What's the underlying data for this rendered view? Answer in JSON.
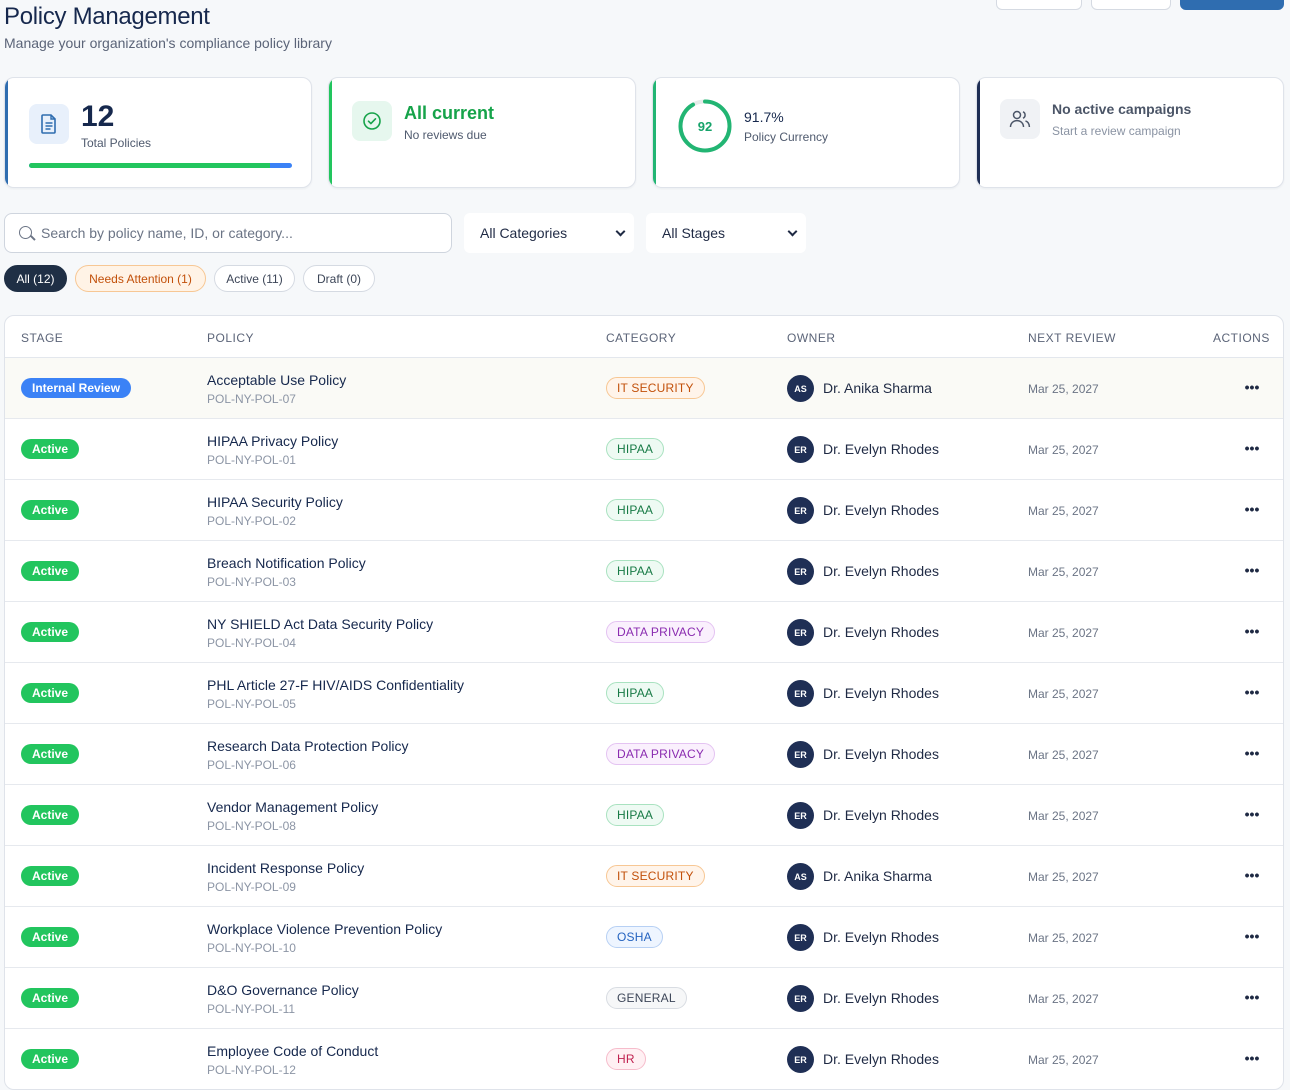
{
  "header": {
    "title": "Policy Management",
    "subtitle": "Manage your organization's compliance policy library"
  },
  "stats": {
    "total": {
      "value": "12",
      "label": "Total Policies",
      "icon": "document-icon",
      "progress_active_fraction": 0.917
    },
    "reviews": {
      "heading": "All current",
      "label": "No reviews due",
      "icon": "check-circle-icon"
    },
    "currency": {
      "ring_value": "92",
      "ring_fraction": 0.917,
      "percent": "91.7%",
      "label": "Policy Currency"
    },
    "campaigns": {
      "heading": "No active campaigns",
      "label": "Start a review campaign",
      "icon": "users-icon"
    }
  },
  "filters": {
    "search_placeholder": "Search by policy name, ID, or category...",
    "category_value": "All Categories",
    "stage_value": "All Stages",
    "chips": [
      {
        "label": "All (12)",
        "selected": true
      },
      {
        "label": "Needs Attention (1)"
      },
      {
        "label": "Active (11)"
      },
      {
        "label": "Draft (0)"
      }
    ]
  },
  "table": {
    "columns": [
      "STAGE",
      "POLICY",
      "CATEGORY",
      "OWNER",
      "NEXT REVIEW",
      "ACTIONS"
    ],
    "rows": [
      {
        "stage": "Internal Review",
        "stage_color": "blue",
        "name": "Acceptable Use Policy",
        "id": "POL-NY-POL-07",
        "category": "IT SECURITY",
        "cat_class": "it",
        "initials": "AS",
        "owner": "Dr. Anika Sharma",
        "next_review": "Mar 25, 2027"
      },
      {
        "stage": "Active",
        "stage_color": "green",
        "name": "HIPAA Privacy Policy",
        "id": "POL-NY-POL-01",
        "category": "HIPAA",
        "cat_class": "hipaa",
        "initials": "ER",
        "owner": "Dr. Evelyn Rhodes",
        "next_review": "Mar 25, 2027"
      },
      {
        "stage": "Active",
        "stage_color": "green",
        "name": "HIPAA Security Policy",
        "id": "POL-NY-POL-02",
        "category": "HIPAA",
        "cat_class": "hipaa",
        "initials": "ER",
        "owner": "Dr. Evelyn Rhodes",
        "next_review": "Mar 25, 2027"
      },
      {
        "stage": "Active",
        "stage_color": "green",
        "name": "Breach Notification Policy",
        "id": "POL-NY-POL-03",
        "category": "HIPAA",
        "cat_class": "hipaa",
        "initials": "ER",
        "owner": "Dr. Evelyn Rhodes",
        "next_review": "Mar 25, 2027"
      },
      {
        "stage": "Active",
        "stage_color": "green",
        "name": "NY SHIELD Act Data Security Policy",
        "id": "POL-NY-POL-04",
        "category": "DATA PRIVACY",
        "cat_class": "dp",
        "initials": "ER",
        "owner": "Dr. Evelyn Rhodes",
        "next_review": "Mar 25, 2027"
      },
      {
        "stage": "Active",
        "stage_color": "green",
        "name": "PHL Article 27-F HIV/AIDS Confidentiality",
        "id": "POL-NY-POL-05",
        "category": "HIPAA",
        "cat_class": "hipaa",
        "initials": "ER",
        "owner": "Dr. Evelyn Rhodes",
        "next_review": "Mar 25, 2027"
      },
      {
        "stage": "Active",
        "stage_color": "green",
        "name": "Research Data Protection Policy",
        "id": "POL-NY-POL-06",
        "category": "DATA PRIVACY",
        "cat_class": "dp",
        "initials": "ER",
        "owner": "Dr. Evelyn Rhodes",
        "next_review": "Mar 25, 2027"
      },
      {
        "stage": "Active",
        "stage_color": "green",
        "name": "Vendor Management Policy",
        "id": "POL-NY-POL-08",
        "category": "HIPAA",
        "cat_class": "hipaa",
        "initials": "ER",
        "owner": "Dr. Evelyn Rhodes",
        "next_review": "Mar 25, 2027"
      },
      {
        "stage": "Active",
        "stage_color": "green",
        "name": "Incident Response Policy",
        "id": "POL-NY-POL-09",
        "category": "IT SECURITY",
        "cat_class": "it",
        "initials": "AS",
        "owner": "Dr. Anika Sharma",
        "next_review": "Mar 25, 2027"
      },
      {
        "stage": "Active",
        "stage_color": "green",
        "name": "Workplace Violence Prevention Policy",
        "id": "POL-NY-POL-10",
        "category": "OSHA",
        "cat_class": "osha",
        "initials": "ER",
        "owner": "Dr. Evelyn Rhodes",
        "next_review": "Mar 25, 2027"
      },
      {
        "stage": "Active",
        "stage_color": "green",
        "name": "D&O Governance Policy",
        "id": "POL-NY-POL-11",
        "category": "GENERAL",
        "cat_class": "gen",
        "initials": "ER",
        "owner": "Dr. Evelyn Rhodes",
        "next_review": "Mar 25, 2027"
      },
      {
        "stage": "Active",
        "stage_color": "green",
        "name": "Employee Code of Conduct",
        "id": "POL-NY-POL-12",
        "category": "HR",
        "cat_class": "hr",
        "initials": "ER",
        "owner": "Dr. Evelyn Rhodes",
        "next_review": "Mar 25, 2027"
      }
    ],
    "actions_glyph": "•••"
  },
  "colors": {
    "brand_blue": "#2f6db0",
    "active_green": "#22c55e",
    "review_blue": "#3b82f6",
    "navy": "#16284d"
  }
}
